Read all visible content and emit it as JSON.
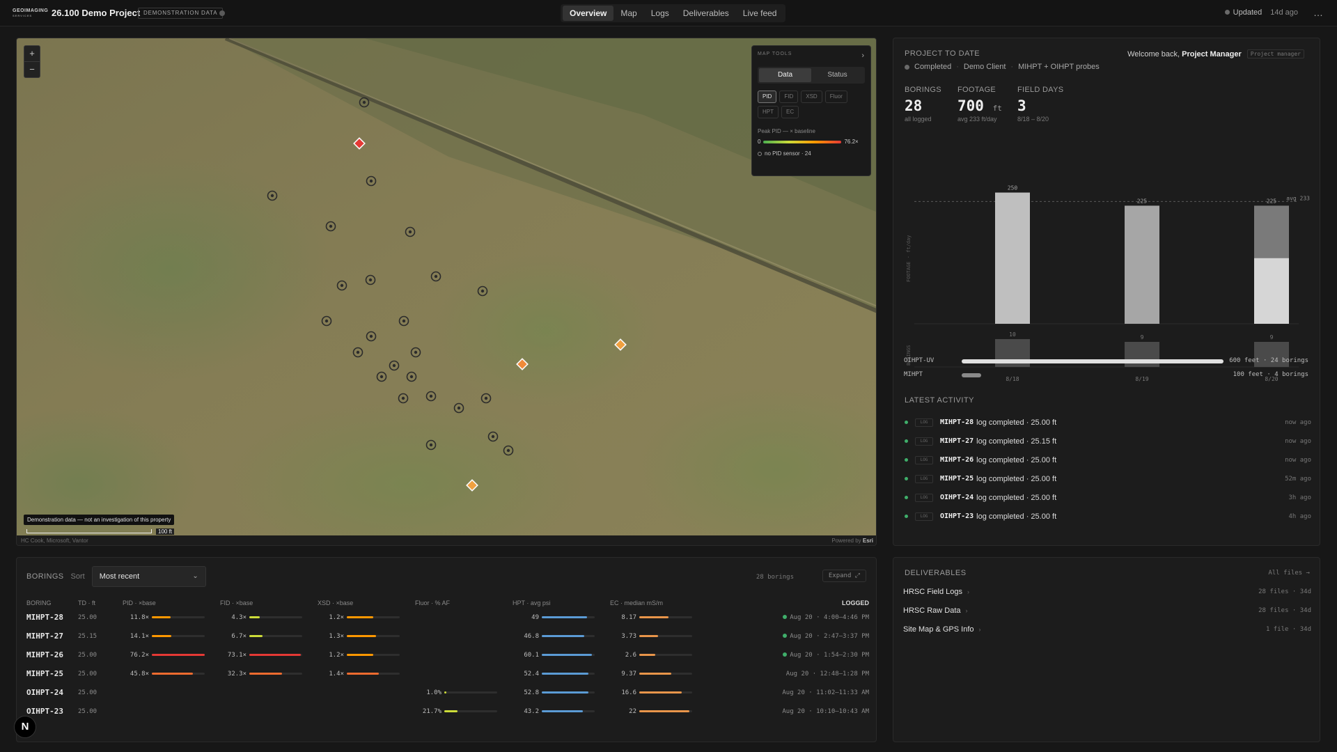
{
  "header": {
    "logo_text": "GEOIMAGING",
    "logo_sub": "SERVICES",
    "project_title": "26.100 Demo Project",
    "badge": "DEMONSTRATION DATA",
    "tabs": [
      "Overview",
      "Map",
      "Logs",
      "Deliverables",
      "Live feed"
    ],
    "active_tab": "Overview",
    "updated_label": "Updated",
    "updated_ago": "14d ago",
    "more_icon": "…"
  },
  "map": {
    "zoom_in": "+",
    "zoom_out": "−",
    "tools": {
      "title": "MAP TOOLS",
      "close": "›",
      "segments": [
        "Data",
        "Status"
      ],
      "active_segment": "Data",
      "chips": [
        "PID",
        "FID",
        "XSD",
        "Fluor",
        "HPT",
        "EC"
      ],
      "active_chip": "PID",
      "legend_title": "Peak PID — × baseline",
      "legend_min": "0",
      "legend_max": "76.2×",
      "no_sensor": "no PID sensor · 24"
    },
    "caption": "Demonstration data — not an investigation of this property",
    "scale_label": "100 ft",
    "attribution": "HC Cook, Microsoft, Vantor",
    "powered_by": "Powered by",
    "powered_by_brand": "Esri"
  },
  "project": {
    "title": "PROJECT TO DATE",
    "status": "Completed",
    "client": "Demo Client",
    "probes": "MIHPT + OIHPT probes",
    "welcome_prefix": "Welcome back,",
    "welcome_name": "Project Manager",
    "role": "Project manager",
    "stats": [
      {
        "key": "BORINGS",
        "value": "28",
        "unit": "",
        "sub": "all logged"
      },
      {
        "key": "FOOTAGE",
        "value": "700",
        "unit": "ft",
        "sub": "avg 233 ft/day"
      },
      {
        "key": "FIELD DAYS",
        "value": "3",
        "unit": "",
        "sub": "8/18 – 8/20"
      }
    ],
    "methods": [
      {
        "name": "OIHPT-UV",
        "text": "600 feet · 24 borings",
        "fraction": 0.86
      },
      {
        "name": "MIHPT",
        "text": "100 feet · 4 borings",
        "fraction": 0.14
      }
    ]
  },
  "chart_data": {
    "type": "bar",
    "categories": [
      "8/18",
      "8/19",
      "8/20"
    ],
    "series": [
      {
        "name": "Footage",
        "values": [
          250,
          225,
          225
        ]
      },
      {
        "name": "Borings",
        "values": [
          10,
          9,
          9
        ]
      }
    ],
    "footage_highlight_portion": [
      0,
      0,
      125
    ],
    "avg_line": 233,
    "avg_label": "avg 233",
    "ylabel_top": "FOOTAGE · ft/day",
    "ylabel_bottom": "BORINGS",
    "ylim_footage": [
      0,
      260
    ],
    "ylim_borings": [
      0,
      12
    ]
  },
  "activity": {
    "title": "LATEST ACTIVITY",
    "tag": "LOG",
    "items": [
      {
        "id": "MIHPT-28",
        "text": "log completed · 25.00 ft",
        "when": "now ago"
      },
      {
        "id": "MIHPT-27",
        "text": "log completed · 25.15 ft",
        "when": "now ago"
      },
      {
        "id": "MIHPT-26",
        "text": "log completed · 25.00 ft",
        "when": "now ago"
      },
      {
        "id": "MIHPT-25",
        "text": "log completed · 25.00 ft",
        "when": "52m ago"
      },
      {
        "id": "OIHPT-24",
        "text": "log completed · 25.00 ft",
        "when": "3h ago"
      },
      {
        "id": "OIHPT-23",
        "text": "log completed · 25.00 ft",
        "when": "4h ago"
      }
    ]
  },
  "borings": {
    "title": "BORINGS",
    "sort_label": "Sort",
    "sort_value": "Most recent",
    "count": "28 borings",
    "expand": "Expand ⤢",
    "columns": [
      "BORING",
      "TD · ft",
      "PID · ×base",
      "FID · ×base",
      "XSD · ×base",
      "Fluor · % AF",
      "HPT · avg psi",
      "EC · median mS/m",
      "LOGGED"
    ],
    "rows": [
      {
        "id": "MIHPT-28",
        "td": "25.00",
        "pid": "11.8×",
        "pid_f": 0.35,
        "fid": "4.3×",
        "fid_f": 0.2,
        "xsd": "1.2×",
        "xsd_f": 0.5,
        "fluor": "",
        "fluor_f": 0,
        "hpt": "49",
        "hpt_f": 0.85,
        "ec": "8.17",
        "ec_f": 0.55,
        "logged": "Aug 20 · 4:00–4:46 PM",
        "recent": true
      },
      {
        "id": "MIHPT-27",
        "td": "25.15",
        "pid": "14.1×",
        "pid_f": 0.37,
        "fid": "6.7×",
        "fid_f": 0.25,
        "xsd": "1.3×",
        "xsd_f": 0.55,
        "fluor": "",
        "fluor_f": 0,
        "hpt": "46.8",
        "hpt_f": 0.8,
        "ec": "3.73",
        "ec_f": 0.35,
        "logged": "Aug 20 · 2:47–3:37 PM",
        "recent": true
      },
      {
        "id": "MIHPT-26",
        "td": "25.00",
        "pid": "76.2×",
        "pid_f": 1.0,
        "fid": "73.1×",
        "fid_f": 0.98,
        "xsd": "1.2×",
        "xsd_f": 0.5,
        "fluor": "",
        "fluor_f": 0,
        "hpt": "60.1",
        "hpt_f": 0.95,
        "ec": "2.6",
        "ec_f": 0.3,
        "logged": "Aug 20 · 1:54–2:30 PM",
        "recent": true
      },
      {
        "id": "MIHPT-25",
        "td": "25.00",
        "pid": "45.8×",
        "pid_f": 0.78,
        "fid": "32.3×",
        "fid_f": 0.62,
        "xsd": "1.4×",
        "xsd_f": 0.6,
        "fluor": "",
        "fluor_f": 0,
        "hpt": "52.4",
        "hpt_f": 0.88,
        "ec": "9.37",
        "ec_f": 0.6,
        "logged": "Aug 20 · 12:48–1:28 PM",
        "recent": false
      },
      {
        "id": "OIHPT-24",
        "td": "25.00",
        "pid": "",
        "pid_f": 0,
        "fid": "",
        "fid_f": 0,
        "xsd": "",
        "xsd_f": 0,
        "fluor": "1.0%",
        "fluor_f": 0.03,
        "hpt": "52.8",
        "hpt_f": 0.88,
        "ec": "16.6",
        "ec_f": 0.8,
        "logged": "Aug 20 · 11:02–11:33 AM",
        "recent": false
      },
      {
        "id": "OIHPT-23",
        "td": "25.00",
        "pid": "",
        "pid_f": 0,
        "fid": "",
        "fid_f": 0,
        "xsd": "",
        "xsd_f": 0,
        "fluor": "21.7%",
        "fluor_f": 0.25,
        "hpt": "43.2",
        "hpt_f": 0.78,
        "ec": "22",
        "ec_f": 0.95,
        "logged": "Aug 20 · 10:10–10:43 AM",
        "recent": false
      }
    ]
  },
  "deliverables": {
    "title": "DELIVERABLES",
    "all_files": "All files →",
    "items": [
      {
        "name": "HRSC Field Logs",
        "meta": "28 files · 34d"
      },
      {
        "name": "HRSC Raw Data",
        "meta": "28 files · 34d"
      },
      {
        "name": "Site Map & GPS Info",
        "meta": "1 file · 34d"
      }
    ]
  },
  "colors": {
    "accent_green": "#3fae6a",
    "pid_high": "#e53935",
    "pid_mid": "#ff9800",
    "hpt_blue": "#5b9bd5",
    "ec_orange": "#e8954a",
    "fluor_yellow": "#cddc39"
  },
  "corner_badge": "N"
}
